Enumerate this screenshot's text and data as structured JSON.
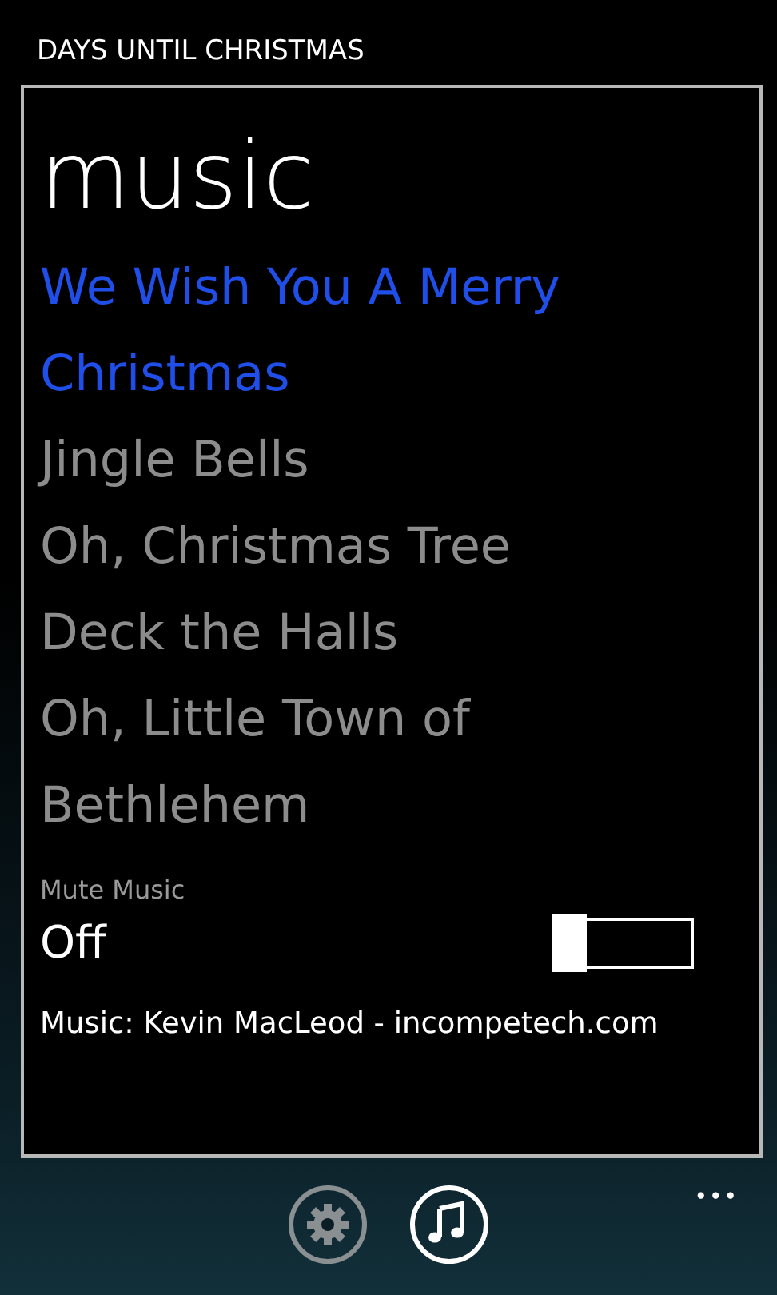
{
  "app_title": "DAYS UNTIL CHRISTMAS",
  "page_title": "music",
  "songs": [
    {
      "title": "We Wish You A Merry Christmas",
      "selected": true
    },
    {
      "title": "Jingle Bells",
      "selected": false
    },
    {
      "title": "Oh, Christmas Tree",
      "selected": false
    },
    {
      "title": "Deck the Halls",
      "selected": false
    },
    {
      "title": "Oh, Little Town of Bethlehem",
      "selected": false
    }
  ],
  "mute_toggle": {
    "label": "Mute Music",
    "value": "Off",
    "on": false
  },
  "credit": "Music: Kevin MacLeod - incompetech.com",
  "app_bar": {
    "buttons": [
      {
        "kind": "settings",
        "selected": false
      },
      {
        "kind": "music",
        "selected": true
      }
    ],
    "more": "•••"
  }
}
